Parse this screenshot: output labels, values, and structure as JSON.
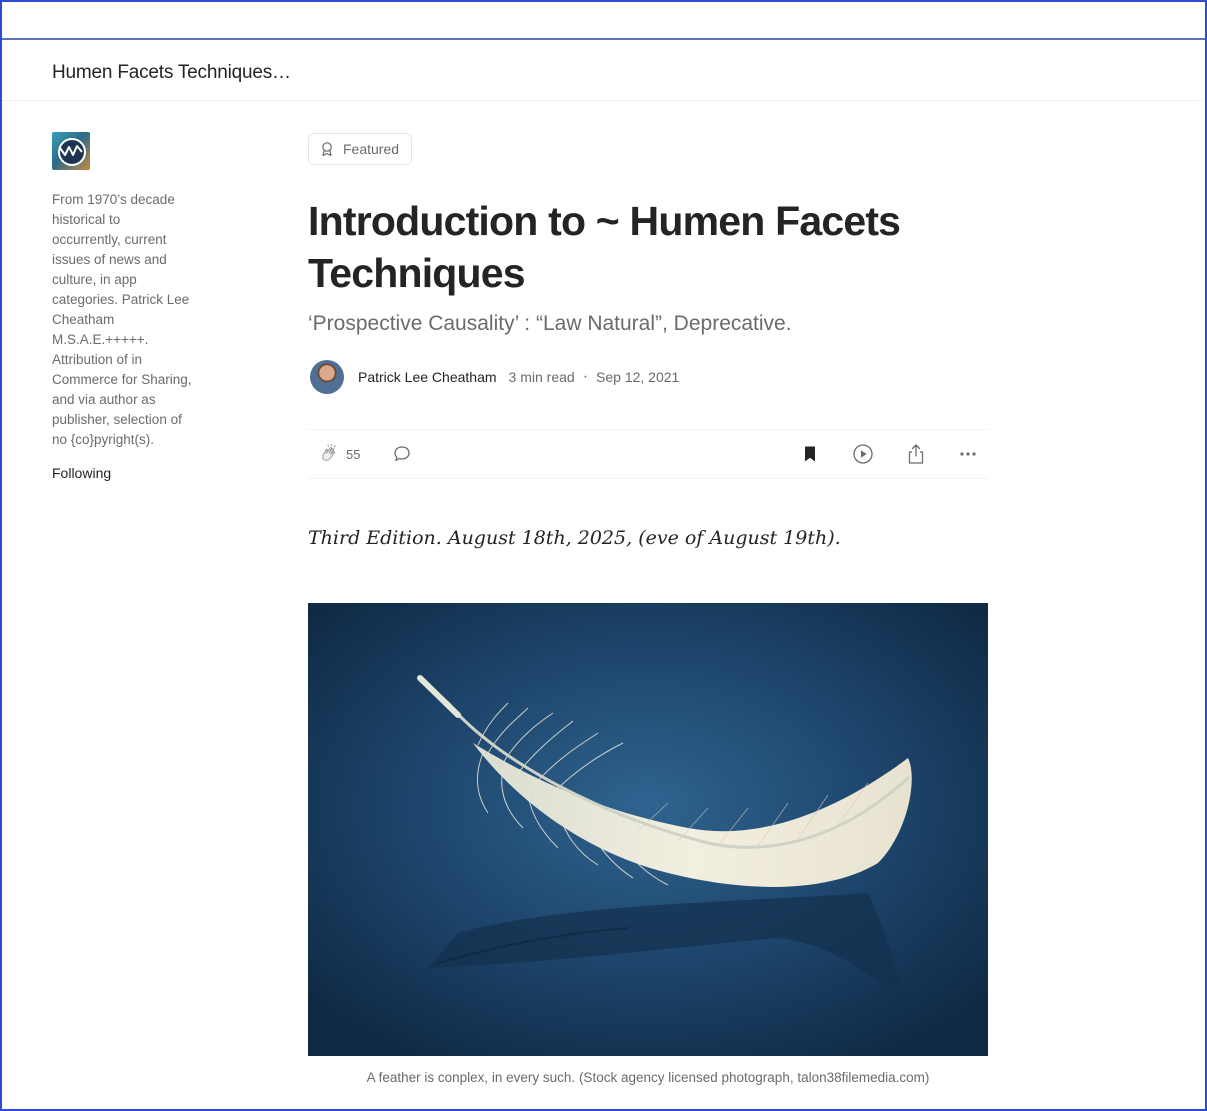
{
  "publication": {
    "name": "Humen Facets Techniques…",
    "description": "From 1970’s decade\nhistorical to\noccurrently, current\nissues of news and\nculture, in app\ncategories. Patrick Lee\nCheatham\nM.S.A.E.+++++.\nAttribution of in\nCommerce for Sharing,\nand via author as\npublisher, selection of\nno {co}pyright(s).",
    "follow_label": "Following"
  },
  "article": {
    "badge": "Featured",
    "title": "Introduction to ~ Humen Facets Techniques",
    "subtitle": "‘Prospective Causality’ : “Law Natural”, Deprecative.",
    "author": "Patrick Lee Cheatham",
    "read_time": "3 min read",
    "separator": "·",
    "date": "Sep 12, 2021",
    "claps": "55",
    "edition_line": "Third Edition. August 18th, 2025, (eve of August 19th).",
    "image_caption": "A feather is conplex, in every such. (Stock agency licensed photograph, talon38filemedia.com)"
  },
  "icons": {
    "featured": "ribbon-icon",
    "clap": "clap-icon",
    "respond": "comment-icon",
    "bookmark": "bookmark-filled-icon",
    "listen": "play-circle-icon",
    "share": "share-icon",
    "more": "more-horizontal-icon"
  },
  "colors": {
    "text_primary": "#242424",
    "text_secondary": "#6b6b6b",
    "frame": "#2f4bd6",
    "image_background": "#1f476c"
  }
}
